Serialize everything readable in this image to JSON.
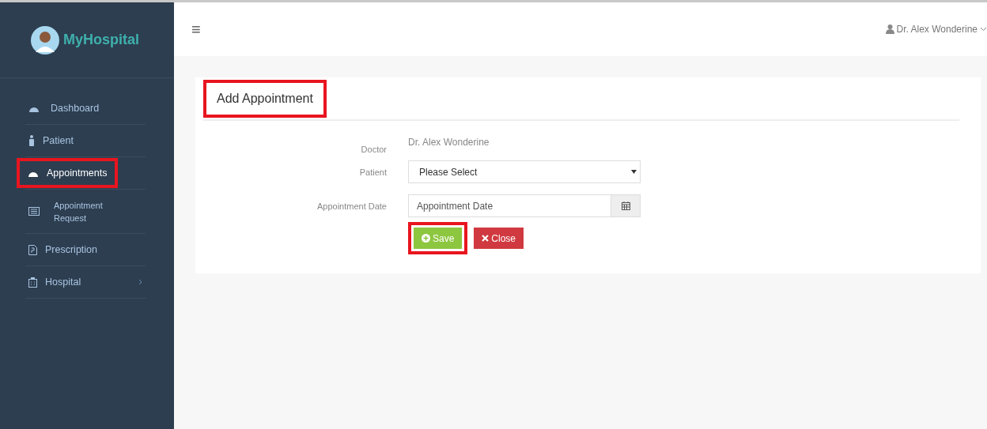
{
  "brand": {
    "name": "MyHospital"
  },
  "sidebar": {
    "items": [
      {
        "label": "Dashboard",
        "kind": "gauge",
        "selected": false,
        "highlighted": false,
        "has_arrow": false
      },
      {
        "label": "Patient",
        "kind": "person",
        "selected": false,
        "highlighted": false,
        "has_arrow": false
      },
      {
        "label": "Appointments",
        "kind": "gauge",
        "selected": true,
        "highlighted": true,
        "has_arrow": false
      },
      {
        "label": "Appointment Request",
        "kind": "list",
        "selected": false,
        "highlighted": false,
        "has_arrow": false
      },
      {
        "label": "Prescription",
        "kind": "doc",
        "selected": false,
        "highlighted": false,
        "has_arrow": false
      },
      {
        "label": "Hospital",
        "kind": "building",
        "selected": false,
        "highlighted": false,
        "has_arrow": true
      }
    ]
  },
  "header": {
    "menu_icon": "≡",
    "user": "Dr. Alex Wonderine"
  },
  "form": {
    "title": "Add Appointment",
    "title_highlighted": true,
    "fields": [
      {
        "kind": "text",
        "label": "Doctor",
        "value": "Dr. Alex Wonderine"
      },
      {
        "kind": "select",
        "label": "Patient",
        "value": "Please Select"
      },
      {
        "kind": "date",
        "label": "Appointment Date",
        "placeholder": "Appointment Date"
      }
    ],
    "buttons": [
      {
        "kind": "save",
        "label": "Save",
        "highlighted": true
      },
      {
        "kind": "close",
        "label": "Close",
        "highlighted": false
      }
    ]
  }
}
